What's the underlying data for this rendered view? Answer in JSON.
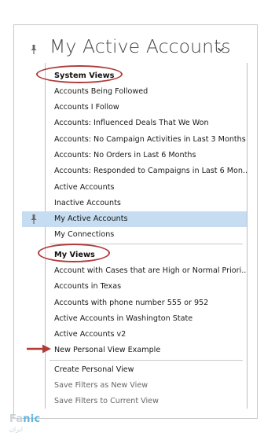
{
  "header": {
    "title": "My Active Accounts",
    "icons": {
      "pin": "pin-icon",
      "chevron": "chevron-down-icon"
    }
  },
  "menu": {
    "system_views_header": "System Views",
    "system_views": [
      "Accounts Being Followed",
      "Accounts I Follow",
      "Accounts: Influenced Deals That We Won",
      "Accounts: No Campaign Activities in Last 3 Months",
      "Accounts: No Orders in Last 6 Months",
      "Accounts: Responded to Campaigns in Last 6 Mon...",
      "Active Accounts",
      "Inactive Accounts",
      "My Active Accounts",
      "My Connections"
    ],
    "selected_view": "My Active Accounts",
    "my_views_header": "My Views",
    "my_views": [
      "Account with Cases that are High or Normal Priori...",
      "Accounts in Texas",
      "Accounts with phone number 555 or 952",
      "Active Accounts in Washington State",
      "Active Accounts v2",
      "New Personal View Example"
    ],
    "actions": [
      "Create Personal View",
      "Save Filters as New View",
      "Save Filters to Current View"
    ]
  },
  "watermark": {
    "brand_prefix": "Fa",
    "brand_accent": "nic",
    "persian": "ایران"
  },
  "colors": {
    "selected_row": "#c5dcf1",
    "annotation": "#b13b3b",
    "brand_accent": "#5fb7e4"
  }
}
